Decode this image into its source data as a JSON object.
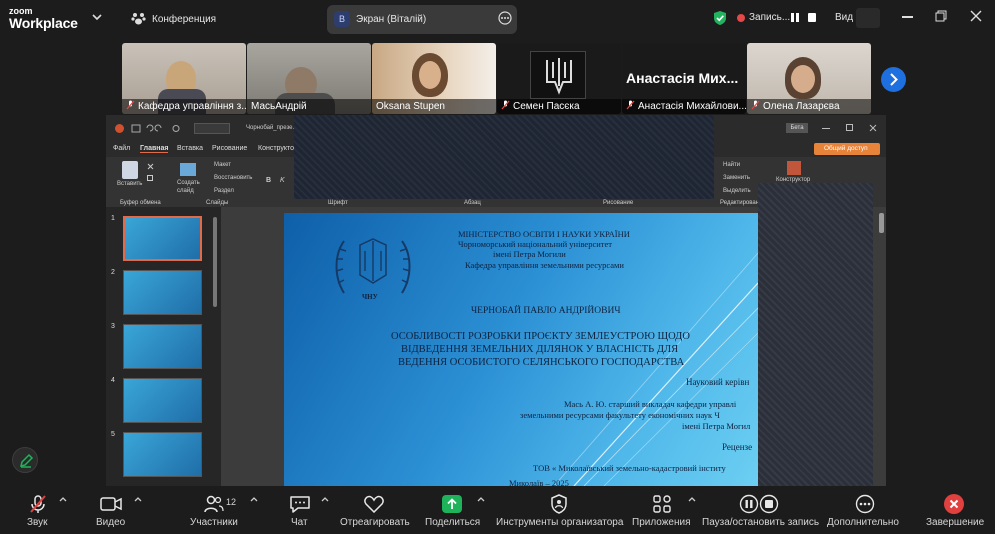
{
  "app": {
    "logo_small": "zoom",
    "logo_big": "Workplace"
  },
  "topbar": {
    "meeting_label": "Конференция",
    "share_badge": "В",
    "share_label": "Экран (Віталій)",
    "record_label": "Запись...",
    "view_label": "Вид"
  },
  "participants": [
    {
      "name": "Кафедра управління з..."
    },
    {
      "name": "МасьАндрій"
    },
    {
      "name": "Oksana Stupen"
    },
    {
      "name": "Семен Пасєка"
    },
    {
      "name": "Анастасія Михайлови...",
      "big_name": "Анастасія Мих..."
    },
    {
      "name": "Олена Лазарєва"
    }
  ],
  "ppt": {
    "title_fragment": "Чорнобай_презе...",
    "beta": "Бета",
    "tabs": [
      "Файл",
      "Главная",
      "Вставка",
      "Рисование",
      "Конструктор"
    ],
    "share_button": "Общий доступ",
    "ribbon": {
      "paste": "Вставить",
      "clipboard_group": "Буфер обмена",
      "create_slide": "Создать слайд",
      "layout": "Макет",
      "restore": "Восстановить",
      "section": "Раздел",
      "slides_group": "Слайды",
      "font_group": "Шрифт",
      "paragraph_group": "Абзац",
      "drawing_group": "Рисование",
      "find": "Найти",
      "replace": "Заменить",
      "select": "Выделить",
      "editing_group": "Редактирование",
      "designer": "Конструктор"
    },
    "slide_numbers": [
      "1",
      "2",
      "3",
      "4",
      "5"
    ],
    "slide": {
      "line1": "МІНІСТЕРСТВО ОСВІТИ І НАУКИ УКРАЇНИ",
      "line2": "Чорноморський національний університет",
      "line3": "імені Петра Могили",
      "line4": "Кафедра управління земельними ресурсами",
      "logo_text": "ЧНУ",
      "author": "ЧЕРНОБАЙ ПАВЛО АНДРІЙОВИЧ",
      "topic1": "ОСОБЛИВОСТІ РОЗРОБКИ ПРОЄКТУ ЗЕМЛЕУСТРОЮ ЩОДО",
      "topic2": "ВІДВЕДЕННЯ ЗЕМЕЛЬНИХ ДІЛЯНОК У ВЛАСНІСТЬ ДЛЯ",
      "topic3": "ВЕДЕННЯ ОСОБИСТОГО СЕЛЯНСЬКОГО ГОСПОДАРСТВА",
      "supervisor_label": "Науковий керівн",
      "supervisor1": "Мась А. Ю. старший викладач кафедри управлі",
      "supervisor2": "земельними ресурсами факультету економічних наук Ч",
      "supervisor3": "імені Петра Могил",
      "reviewer_label": "Рецензе",
      "reviewer1": "ТОВ « Миколаївський земельно-кадастровий інститу",
      "city": "Миколаїв – 2025"
    }
  },
  "toolbar": [
    {
      "label": "Звук"
    },
    {
      "label": "Видео"
    },
    {
      "label": "Участники",
      "count": "12"
    },
    {
      "label": "Чат"
    },
    {
      "label": "Отреагировать"
    },
    {
      "label": "Поделиться"
    },
    {
      "label": "Инструменты организатора"
    },
    {
      "label": "Приложения"
    },
    {
      "label": "Пауза/остановить запись"
    },
    {
      "label": "Дополнительно"
    },
    {
      "label": "Завершение"
    }
  ],
  "colors": {
    "share_green": "#1eb35a",
    "end_red": "#e0413f",
    "record_red": "#e54848"
  }
}
